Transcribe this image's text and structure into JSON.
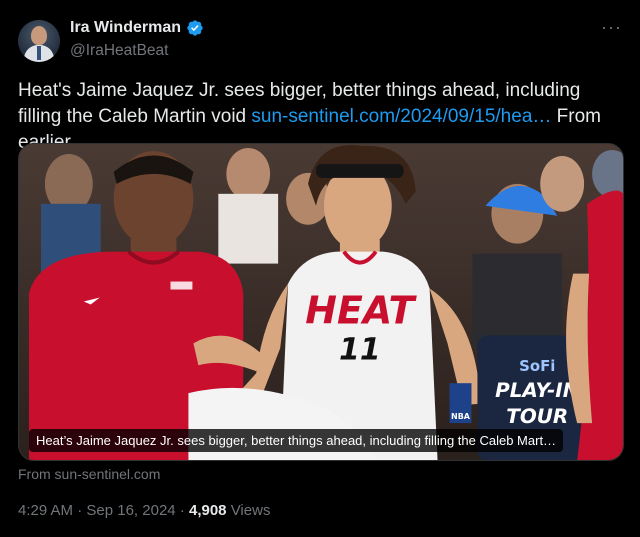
{
  "author": {
    "display_name": "Ira Winderman",
    "handle": "@IraHeatBeat",
    "verified": true,
    "avatar_icon": "user-avatar"
  },
  "more_icon": "ellipsis-icon",
  "tweet": {
    "text_main": "Heat's Jaime Jaquez Jr. sees bigger, better things ahead, including filling the Caleb Martin void",
    "link_text": "sun-sentinel.com/2024/09/15/hea…",
    "text_after": "From earlier."
  },
  "card": {
    "caption": "Heat’s Jaime Jaquez Jr. sees bigger, better things ahead, including filling the Caleb Mart…",
    "source": "From sun-sentinel.com",
    "jersey_team": "HEAT",
    "jersey_number": "11",
    "sign_line1": "SoFi",
    "sign_line2": "PLAY-IN",
    "sign_line3": "TOUR",
    "nba_logo": "NBA"
  },
  "meta": {
    "time": "4:29 AM",
    "date": "Sep 16, 2024",
    "separator": "·",
    "views_count": "4,908",
    "views_label": "Views"
  },
  "colors": {
    "background": "#000000",
    "text": "#e7e9ea",
    "muted": "#71767b",
    "link": "#1d9bf0",
    "verified": "#1d9bf0",
    "heat_red": "#c8102e"
  }
}
